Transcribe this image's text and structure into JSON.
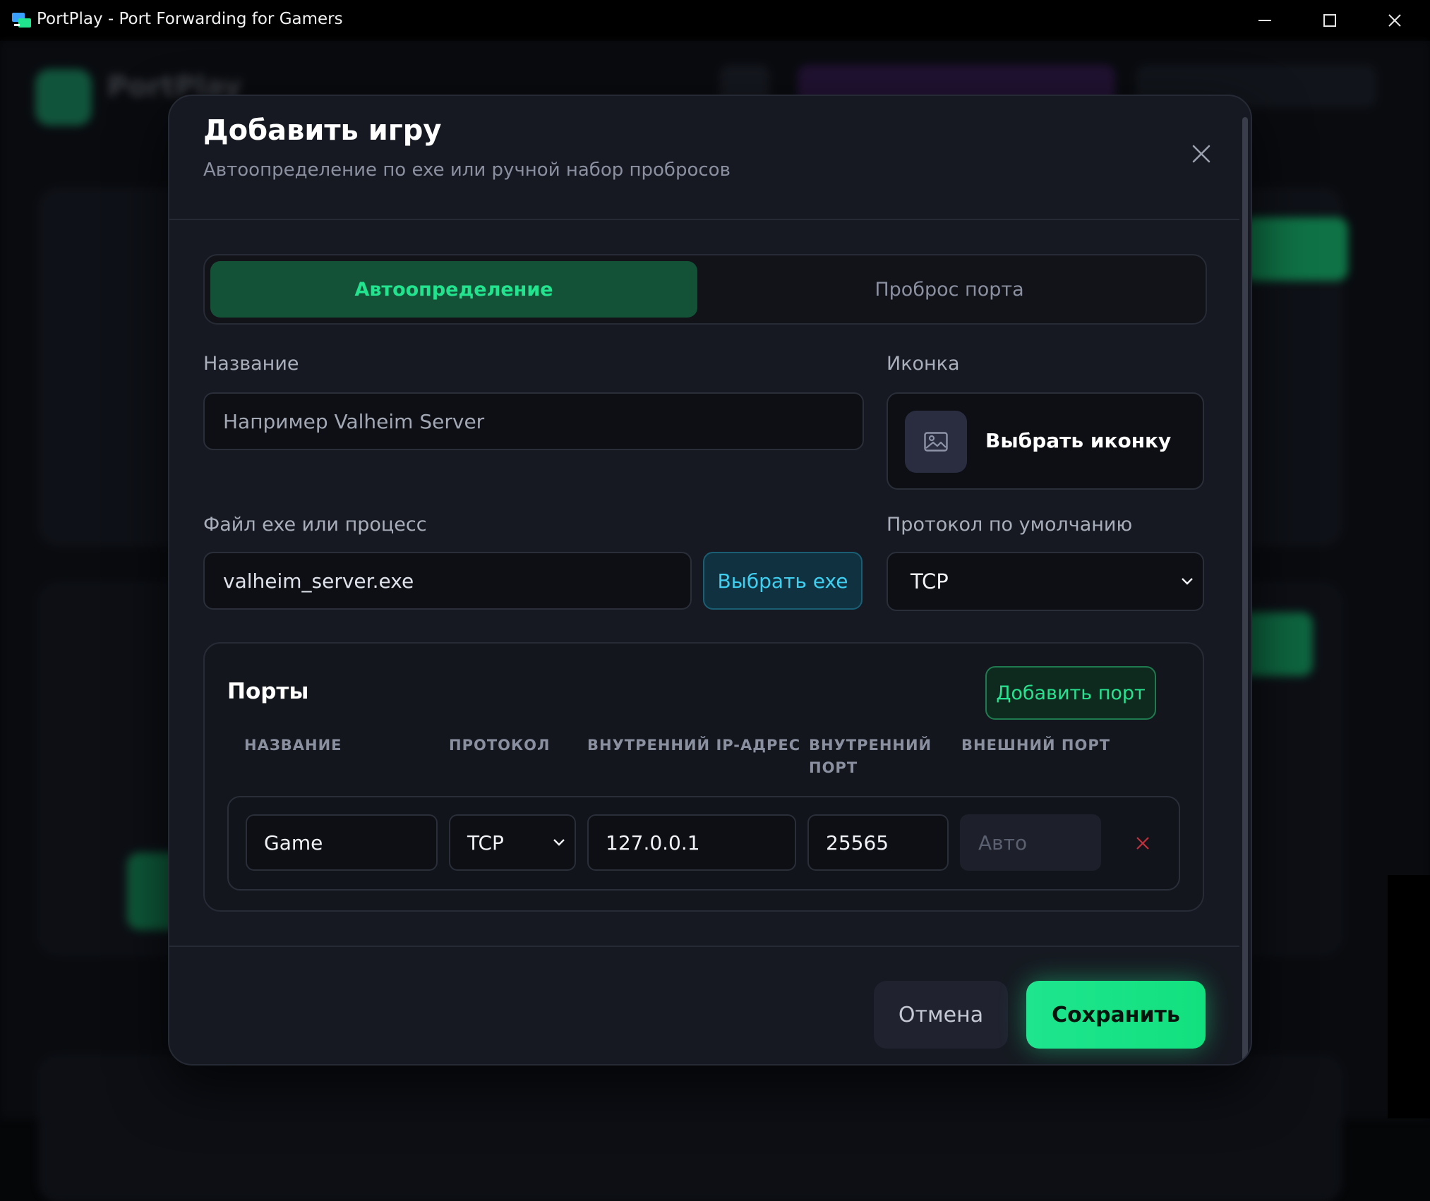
{
  "window": {
    "title": "PortPlay - Port Forwarding for Gamers"
  },
  "background": {
    "brand": "PortPlay"
  },
  "dialog": {
    "title": "Добавить игру",
    "subtitle": "Автоопределение по exe или ручной набор пробросов",
    "tabs": [
      {
        "label": "Автоопределение",
        "active": true
      },
      {
        "label": "Проброс порта",
        "active": false
      }
    ],
    "name_field": {
      "label": "Название",
      "placeholder": "Например Valheim Server",
      "value": ""
    },
    "icon_field": {
      "label": "Иконка",
      "button_label": "Выбрать иконку",
      "icon": "image-icon"
    },
    "exe_field": {
      "label": "Файл exe или процесс",
      "value": "valheim_server.exe",
      "button_label": "Выбрать exe"
    },
    "protocol_field": {
      "label": "Протокол по умолчанию",
      "value": "TCP"
    },
    "ports": {
      "title": "Порты",
      "add_label": "Добавить порт",
      "columns": [
        "НАЗВАНИЕ",
        "ПРОТОКОЛ",
        "ВНУТРЕННИЙ IP-АДРЕС",
        "ВНУТРЕННИЙ ПОРТ",
        "ВНЕШНИЙ ПОРТ"
      ],
      "rows": [
        {
          "name": "Game",
          "protocol": "TCP",
          "internal_ip": "127.0.0.1",
          "internal_port": "25565",
          "external_port_placeholder": "Авто"
        }
      ]
    },
    "cancel_label": "Отмена",
    "save_label": "Сохранить"
  },
  "colors": {
    "accent": "#1ee58e",
    "tab_active_bg": "#145238",
    "exe_button_text": "#3fcff0",
    "delete_icon": "#c0313d",
    "dialog_bg": "#161921"
  }
}
